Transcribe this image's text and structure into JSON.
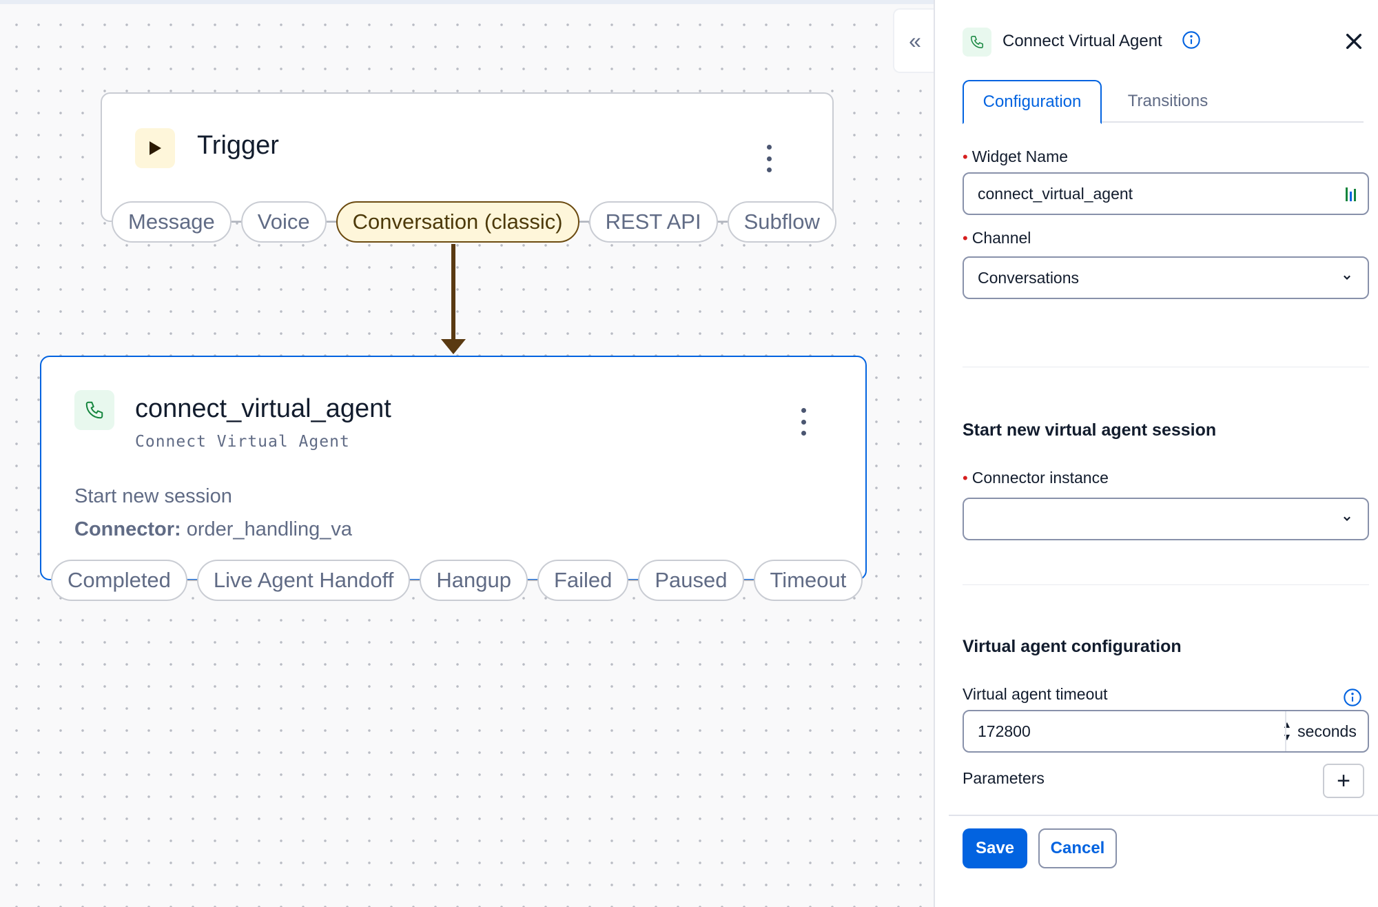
{
  "canvas": {
    "trigger_node": {
      "title": "Trigger",
      "icon": "play-icon",
      "transitions": [
        "Message",
        "Voice",
        "Conversation (classic)",
        "REST API",
        "Subflow"
      ],
      "active_transition": "Conversation (classic)"
    },
    "widget_node": {
      "title": "connect_virtual_agent",
      "subtitle": "Connect Virtual Agent",
      "icon": "phone-icon",
      "line1": "Start new session",
      "connector_label": "Connector:",
      "connector_value": "order_handling_va",
      "transitions": [
        "Completed",
        "Live Agent Handoff",
        "Hangup",
        "Failed",
        "Paused",
        "Timeout"
      ]
    }
  },
  "panel": {
    "collapse_label": "«",
    "title": "Connect Virtual Agent",
    "tabs": {
      "configuration": "Configuration",
      "transitions": "Transitions"
    },
    "widget_name": {
      "label": "Widget Name",
      "value": "connect_virtual_agent"
    },
    "channel": {
      "label": "Channel",
      "value": "Conversations"
    },
    "section_session": "Start new virtual agent session",
    "connector_instance": {
      "label": "Connector instance",
      "value": ""
    },
    "section_config": "Virtual agent configuration",
    "timeout": {
      "label": "Virtual agent timeout",
      "value": "172800",
      "unit": "seconds"
    },
    "parameters_label": "Parameters",
    "add_label": "+",
    "save_label": "Save",
    "cancel_label": "Cancel"
  },
  "colors": {
    "accent": "#0263e0",
    "trigger_active_fill": "#fef6da",
    "arrow": "#5a3a12",
    "required": "#d61f1f"
  }
}
